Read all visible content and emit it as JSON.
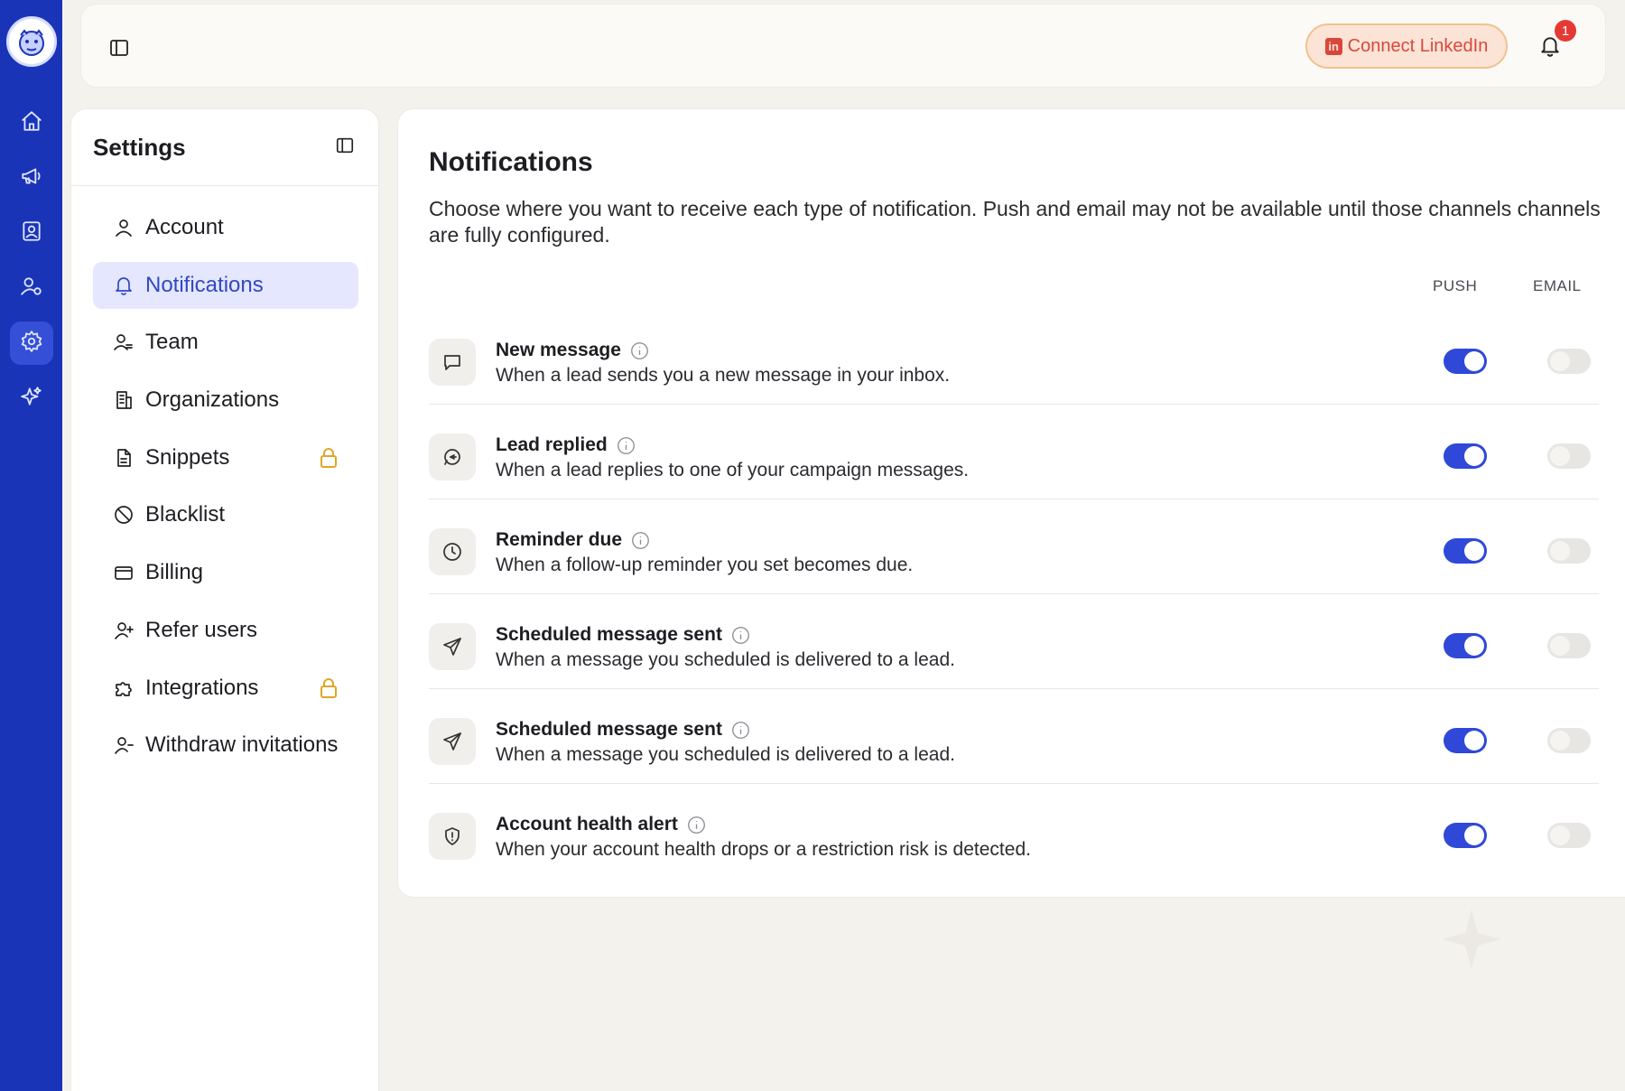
{
  "app": {
    "accent": "#2f48d8",
    "rail_color": "#1a34b8"
  },
  "rail": {
    "logo_icon": "bulldog-logo-icon",
    "items": [
      {
        "name": "home-icon"
      },
      {
        "name": "megaphone-icon"
      },
      {
        "name": "contact-card-icon"
      },
      {
        "name": "user-settings-icon"
      },
      {
        "name": "gear-icon",
        "active": true
      },
      {
        "name": "sparkles-icon"
      }
    ]
  },
  "topbar": {
    "sidebar_toggle_icon": "sidebar-toggle-icon",
    "linkedin_label": "Connect LinkedIn",
    "notification_count": "1"
  },
  "settings": {
    "title": "Settings",
    "nav": [
      {
        "label": "Account",
        "icon": "user-icon"
      },
      {
        "label": "Notifications",
        "icon": "bell-icon",
        "active": true
      },
      {
        "label": "Team",
        "icon": "team-icon"
      },
      {
        "label": "Organizations",
        "icon": "building-icon"
      },
      {
        "label": "Snippets",
        "icon": "document-icon",
        "locked": true
      },
      {
        "label": "Blacklist",
        "icon": "ban-icon"
      },
      {
        "label": "Billing",
        "icon": "credit-card-icon"
      },
      {
        "label": "Refer users",
        "icon": "user-plus-icon"
      },
      {
        "label": "Integrations",
        "icon": "puzzle-icon",
        "locked": true
      },
      {
        "label": "Withdraw invitations",
        "icon": "user-minus-icon"
      }
    ]
  },
  "main": {
    "title": "Notifications",
    "description": "Choose where you want to receive each type of notification. Push and email may not be available until those channels channels are fully configured.",
    "col_push": "PUSH",
    "col_email": "EMAIL",
    "rows": [
      {
        "title": "New message",
        "desc": "When a lead sends you a new message in your inbox.",
        "icon": "message-icon",
        "push": true,
        "email": false
      },
      {
        "title": "Lead replied",
        "desc": "When a lead replies to one of your campaign messages.",
        "icon": "reply-icon",
        "push": true,
        "email": false
      },
      {
        "title": "Reminder due",
        "desc": "When a follow-up reminder you set becomes due.",
        "icon": "clock-icon",
        "push": true,
        "email": false
      },
      {
        "title": "Scheduled message sent",
        "desc": "When a message you scheduled is delivered to a lead.",
        "icon": "send-icon",
        "push": true,
        "email": false
      },
      {
        "title": "Scheduled message sent",
        "desc": "When a message you scheduled is delivered to a lead.",
        "icon": "send-icon",
        "push": true,
        "email": false
      },
      {
        "title": "Account health alert",
        "desc": "When your account health drops or a restriction risk is detected.",
        "icon": "shield-alert-icon",
        "push": true,
        "email": false
      }
    ]
  }
}
